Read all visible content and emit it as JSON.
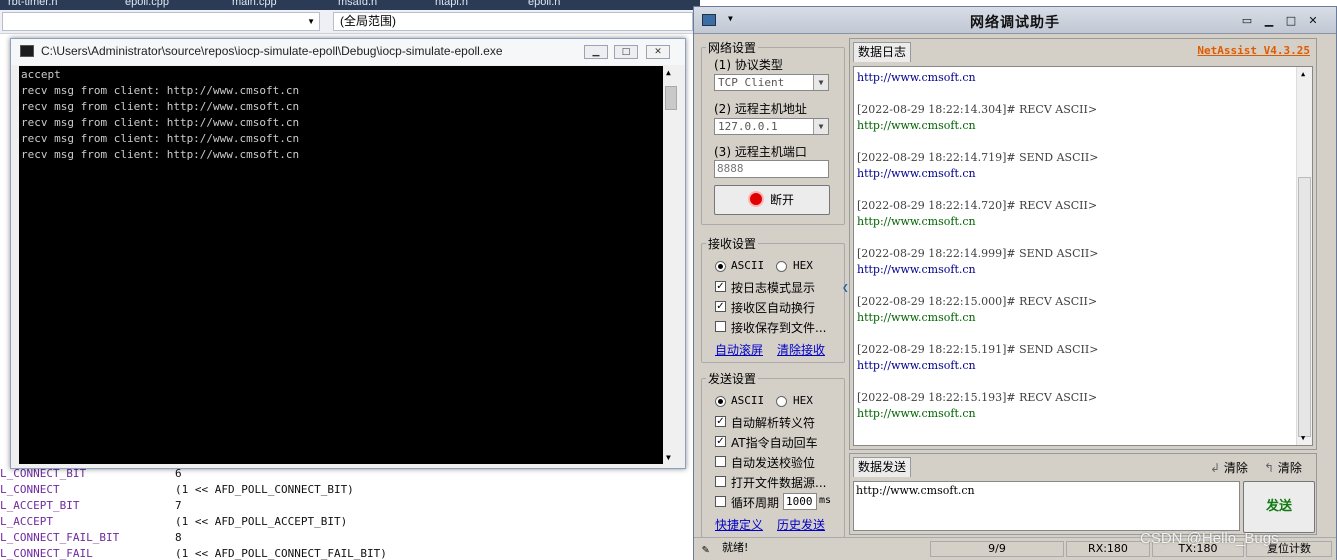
{
  "ide": {
    "tabs": [
      "rbt-timer.h",
      "epoll.cpp",
      "main.cpp",
      "msafd.h",
      "ntapi.h",
      "epoll.h"
    ],
    "scope": "(全局范围)",
    "code_lines": [
      {
        "name": "L_CONNECT_BIT",
        "value": "6"
      },
      {
        "name": "L_CONNECT",
        "value": "(1 << AFD_POLL_CONNECT_BIT)"
      },
      {
        "name": "L_ACCEPT_BIT",
        "value": "7"
      },
      {
        "name": "L_ACCEPT",
        "value": "(1 << AFD_POLL_ACCEPT_BIT)"
      },
      {
        "name": "L_CONNECT_FAIL_BIT",
        "value": "8"
      },
      {
        "name": "L_CONNECT_FAIL",
        "value": "(1 << AFD_POLL_CONNECT_FAIL_BIT)"
      }
    ]
  },
  "console": {
    "title": "C:\\Users\\Administrator\\source\\repos\\iocp-simulate-epoll\\Debug\\iocp-simulate-epoll.exe",
    "lines": [
      "accept",
      "recv msg from client: http://www.cmsoft.cn",
      "recv msg from client: http://www.cmsoft.cn",
      "recv msg from client: http://www.cmsoft.cn",
      "recv msg from client: http://www.cmsoft.cn",
      "recv msg from client: http://www.cmsoft.cn"
    ]
  },
  "netassist": {
    "title": "网络调试助手",
    "brand": "NetAssist V4.3.25",
    "net": {
      "header": "网络设置",
      "protocol_label": "(1) 协议类型",
      "protocol_value": "TCP Client",
      "host_label": "(2) 远程主机地址",
      "host_value": "127.0.0.1",
      "port_label": "(3) 远程主机端口",
      "port_value": "8888",
      "disconnect": "断开"
    },
    "recv": {
      "header": "接收设置",
      "ascii": "ASCII",
      "hex": "HEX",
      "opt1": "按日志模式显示",
      "opt2": "接收区自动换行",
      "opt3": "接收保存到文件...",
      "link1": "自动滚屏",
      "link2": "清除接收"
    },
    "send": {
      "header": "发送设置",
      "ascii": "ASCII",
      "hex": "HEX",
      "opt1": "自动解析转义符",
      "opt2": "AT指令自动回车",
      "opt3": "自动发送校验位",
      "opt4": "打开文件数据源...",
      "opt5": "循环周期",
      "period": "1000",
      "period_unit": "ms",
      "link1": "快捷定义",
      "link2": "历史发送"
    },
    "log_tab": "数据日志",
    "log_first_data": "http://www.cmsoft.cn",
    "log": [
      {
        "head": "[2022-08-29 18:22:14.304]# RECV ASCII>",
        "data": "http://www.cmsoft.cn",
        "kind": "recv"
      },
      {
        "head": "[2022-08-29 18:22:14.719]# SEND ASCII>",
        "data": "http://www.cmsoft.cn",
        "kind": "send"
      },
      {
        "head": "[2022-08-29 18:22:14.720]# RECV ASCII>",
        "data": "http://www.cmsoft.cn",
        "kind": "recv"
      },
      {
        "head": "[2022-08-29 18:22:14.999]# SEND ASCII>",
        "data": "http://www.cmsoft.cn",
        "kind": "send"
      },
      {
        "head": "[2022-08-29 18:22:15.000]# RECV ASCII>",
        "data": "http://www.cmsoft.cn",
        "kind": "recv"
      },
      {
        "head": "[2022-08-29 18:22:15.191]# SEND ASCII>",
        "data": "http://www.cmsoft.cn",
        "kind": "send"
      },
      {
        "head": "[2022-08-29 18:22:15.193]# RECV ASCII>",
        "data": "http://www.cmsoft.cn",
        "kind": "recv"
      }
    ],
    "send_tab": "数据发送",
    "clear1": "清除",
    "clear2": "清除",
    "send_text": "http://www.cmsoft.cn",
    "send_button": "发送",
    "status": {
      "ready": "就绪!",
      "count": "9/9",
      "rx": "RX:180",
      "tx": "TX:180",
      "reset": "复位计数"
    }
  },
  "watermark": "CSDN @Hello_Bugs"
}
